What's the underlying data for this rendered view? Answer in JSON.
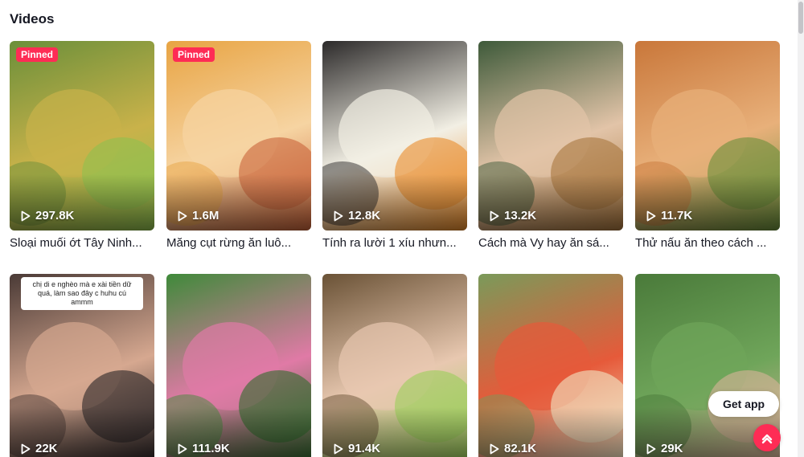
{
  "section": {
    "title": "Videos"
  },
  "videos": [
    {
      "views": "297.8K",
      "caption": "Sloại muối ớt Tây Ninh...",
      "pinned": "Pinned",
      "bg": [
        "#6b8f3a",
        "#c9b24a",
        "#8fbf4e"
      ]
    },
    {
      "views": "1.6M",
      "caption": "Măng cụt rừng ăn luô...",
      "pinned": "Pinned",
      "bg": [
        "#e8a443",
        "#f6d4a2",
        "#c9643a"
      ]
    },
    {
      "views": "12.8K",
      "caption": "Tính ra lười 1 xíu nhưn...",
      "pinned": "",
      "bg": [
        "#2c2a2a",
        "#f2efe4",
        "#e98c2b"
      ]
    },
    {
      "views": "13.2K",
      "caption": "Cách mà Vy hay ăn sá...",
      "pinned": "",
      "bg": [
        "#3e5a3a",
        "#e2c4a8",
        "#a8763e"
      ]
    },
    {
      "views": "11.7K",
      "caption": "Thử nấu ăn theo cách ...",
      "pinned": "",
      "bg": [
        "#c9773a",
        "#e8b07a",
        "#6a8f3b"
      ]
    },
    {
      "views": "22K",
      "caption": "",
      "pinned": "",
      "overlay": "chị di e nghèo mà e xài tiền dữ quá, làm sao đây c huhu cú ammm",
      "bg": [
        "#4a3a36",
        "#d6a890",
        "#2a2426"
      ]
    },
    {
      "views": "111.9K",
      "caption": "",
      "pinned": "",
      "bg": [
        "#3f8a3a",
        "#e07aa6",
        "#2f6a2c"
      ]
    },
    {
      "views": "91.4K",
      "caption": "",
      "pinned": "",
      "bg": [
        "#6a5236",
        "#e8c8b0",
        "#9bcf5a"
      ]
    },
    {
      "views": "82.1K",
      "caption": "",
      "pinned": "",
      "bg": [
        "#7a9a5a",
        "#e65a3a",
        "#f2e6c4"
      ]
    },
    {
      "views": "29K",
      "caption": "",
      "pinned": "",
      "bg": [
        "#4a7a3a",
        "#6fa55a",
        "#d9b49a"
      ]
    }
  ],
  "get_app": {
    "label": "Get app"
  },
  "icons": {
    "play": "play-icon",
    "back_to_top": "arrow-up-icon"
  },
  "colors": {
    "accent": "#fe2c55",
    "text": "#161823"
  }
}
